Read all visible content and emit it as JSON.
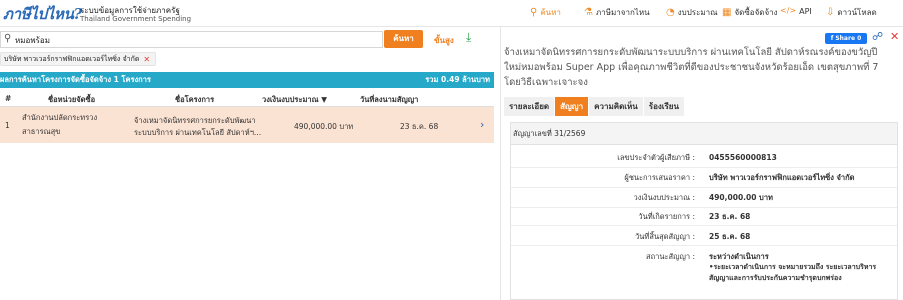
{
  "header": {
    "logo": "ภาษีไปไหน?",
    "subtitle_th": "ระบบข้อมูลการใช้จ่ายภาครัฐ",
    "subtitle_en": "Thailand Government Spending",
    "nav": [
      {
        "label": "ค้นหา",
        "icon": "search-icon",
        "glyph": "🔍",
        "active": true
      },
      {
        "label": "ภาษีมาจากไหน",
        "icon": "coins-icon",
        "glyph": "⚐",
        "active": false
      },
      {
        "label": "งบประมาณ",
        "icon": "budget-icon",
        "glyph": "◔",
        "active": false
      },
      {
        "label": "จัดซื้อจัดจ้าง",
        "icon": "procurement-icon",
        "glyph": "▦",
        "active": false
      },
      {
        "label": "API",
        "icon": "code-icon",
        "glyph": "</>",
        "active": false
      },
      {
        "label": "ดาวน์โหลด",
        "icon": "download-icon",
        "glyph": "⇩",
        "active": false
      }
    ]
  },
  "search": {
    "value": "หมอพร้อม",
    "button": "ค้นหา",
    "advanced": "ขั้นสูง",
    "filter_chip": "บริษัท พาวเวอร์กราฟฟิกแอดเวอร์ไทซิ่ง จำกัด"
  },
  "results": {
    "summary": "ผลการค้นหาโครงการจัดซื้อจัดจ้าง 1 โครงการ",
    "total": "รวม 0.49 ล้านบาท",
    "columns": {
      "num": "#",
      "agency": "ชื่อหน่วยจัดซื้อ",
      "project": "ชื่อโครงการ",
      "budget": "วงเงินงบประมาณ",
      "date": "วันที่ลงนามสัญญา"
    },
    "rows": [
      {
        "num": "1",
        "agency_l1": "สำนักงานปลัดกระทรวง",
        "agency_l2": "สาธารณสุข",
        "project_l1": "จ้างเหมาจัดนิทรรศการยกระดับพัฒนา",
        "project_l2": "ระบบบริการ ผ่านเทคโนโลยี สัปดาห์ฯ...",
        "budget": "490,000.00 บาท",
        "date": "23 ธ.ค. 68"
      }
    ]
  },
  "detail": {
    "fb_share": "Share 0",
    "title": "จ้างเหมาจัดนิทรรศการยกระดับพัฒนาระบบบริการ ผ่านเทคโนโลยี สัปดาห์รณรงค์ของขวัญปีใหม่หมอพร้อม Super App เพื่อคุณภาพชีวิตที่ดีของประชาชนจังหวัดร้อยเอ็ด เขตสุขภาพที่ 7 โดยวิธีเฉพาะเจาะจง",
    "tabs": [
      "รายละเอียด",
      "สัญญา",
      "ความคิดเห็น",
      "ร้องเรียน"
    ],
    "active_tab": 1,
    "contract_no": "สัญญาเลขที่ 31/2569",
    "fields": [
      {
        "label": "เลขประจำตัวผู้เสียภาษี :",
        "value": "0455560000813"
      },
      {
        "label": "ผู้ชนะการเสนอราคา :",
        "value": "บริษัท พาวเวอร์กราฟฟิกแอดเวอร์ไทซิ่ง จำกัด"
      },
      {
        "label": "วงเงินงบประมาณ :",
        "value": "490,000.00 บาท"
      },
      {
        "label": "วันที่เกิดรายการ :",
        "value": "23 ธ.ค. 68"
      },
      {
        "label": "วันที่สิ้นสุดสัญญา :",
        "value": "25 ธ.ค. 68"
      },
      {
        "label": "สถานะสัญญา :",
        "value": "ระหว่างดำเนินการ",
        "value2": "•ระยะเวลาดำเนินการ จะหมายรวมถึง ระยะเวลาบริหารสัญญาและการรับประกันความชำรุดบกพร่อง"
      }
    ]
  }
}
